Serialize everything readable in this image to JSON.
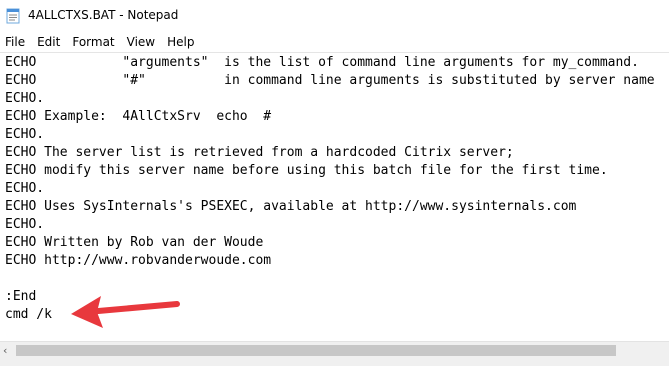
{
  "window": {
    "title": "4ALLCTXS.BAT - Notepad",
    "icon": "notepad-icon"
  },
  "menu": [
    {
      "label": "File"
    },
    {
      "label": "Edit"
    },
    {
      "label": "Format"
    },
    {
      "label": "View"
    },
    {
      "label": "Help"
    }
  ],
  "editor": {
    "lines": [
      "ECHO           \"arguments\"  is the list of command line arguments for my_command.",
      "ECHO           \"#\"          in command line arguments is substituted by server name",
      "ECHO.",
      "ECHO Example:  4AllCtxSrv  echo  #",
      "ECHO.",
      "ECHO The server list is retrieved from a hardcoded Citrix server;",
      "ECHO modify this server name before using this batch file for the first time.",
      "ECHO.",
      "ECHO Uses SysInternals's PSEXEC, available at http://www.sysinternals.com",
      "ECHO.",
      "ECHO Written by Rob van der Woude",
      "ECHO http://www.robvanderwoude.com",
      "",
      ":End",
      "cmd /k"
    ]
  },
  "annotation": {
    "color": "#e8383d",
    "icon": "red-arrow-icon"
  },
  "scrollbar": {
    "left_arrow": "‹"
  }
}
